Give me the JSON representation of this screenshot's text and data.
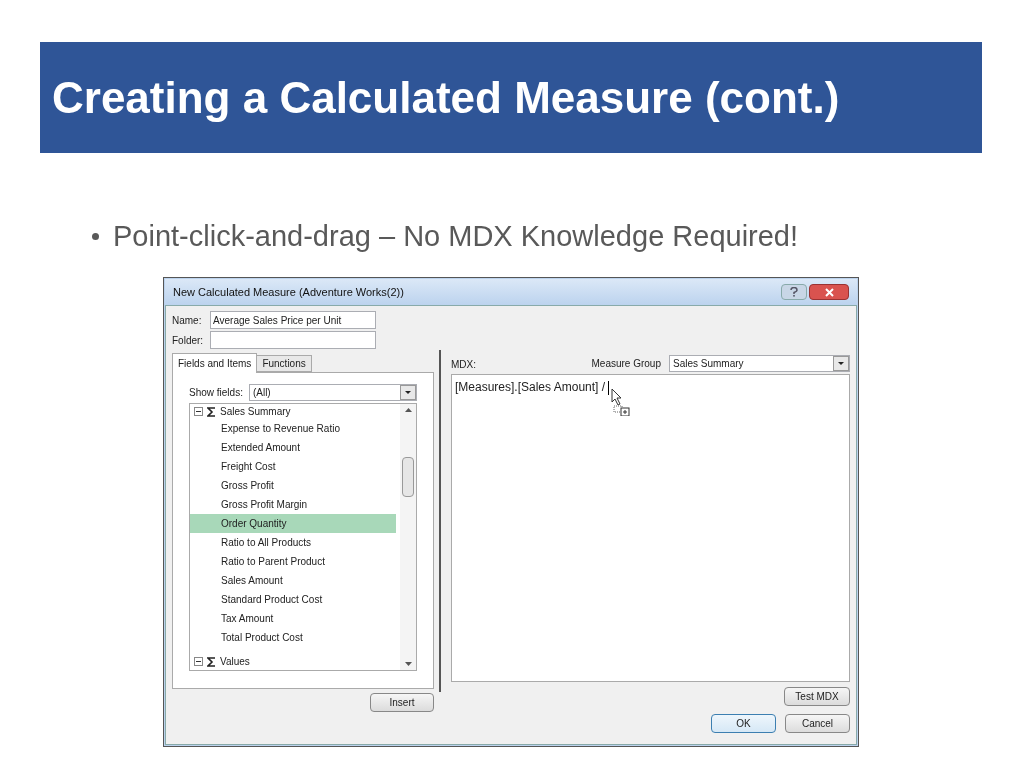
{
  "slide": {
    "title": "Creating a Calculated Measure (cont.)",
    "bullets": [
      "Point-click-and-drag – No MDX Knowledge Required!"
    ]
  },
  "dialog": {
    "title": "New Calculated Measure (Adventure Works(2))",
    "name_label": "Name:",
    "name_value": "Average Sales Price per Unit",
    "folder_label": "Folder:",
    "tabs": [
      {
        "label": "Fields and Items",
        "selected": true
      },
      {
        "label": "Functions",
        "selected": false
      }
    ],
    "show_fields_label": "Show fields:",
    "show_fields_value": "(All)",
    "tree": [
      {
        "label": "Sales Summary",
        "expanded": true,
        "children": [
          {
            "label": "Expense to Revenue Ratio",
            "selected": false
          },
          {
            "label": "Extended Amount",
            "selected": false
          },
          {
            "label": "Freight Cost",
            "selected": false
          },
          {
            "label": "Gross Profit",
            "selected": false
          },
          {
            "label": "Gross Profit Margin",
            "selected": false
          },
          {
            "label": "Order Quantity",
            "selected": true
          },
          {
            "label": "Ratio to All Products",
            "selected": false
          },
          {
            "label": "Ratio to Parent Product",
            "selected": false
          },
          {
            "label": "Sales Amount",
            "selected": false
          },
          {
            "label": "Standard Product Cost",
            "selected": false
          },
          {
            "label": "Tax Amount",
            "selected": false
          },
          {
            "label": "Total Product Cost",
            "selected": false
          }
        ]
      },
      {
        "label": "Values",
        "expanded": true
      }
    ],
    "insert_button": "Insert",
    "mdx_label": "MDX:",
    "measure_group_label": "Measure Group",
    "measure_group_value": "Sales Summary",
    "mdx_value": "[Measures].[Sales Amount] /",
    "test_button": "Test MDX",
    "ok_button": "OK",
    "cancel_button": "Cancel"
  }
}
